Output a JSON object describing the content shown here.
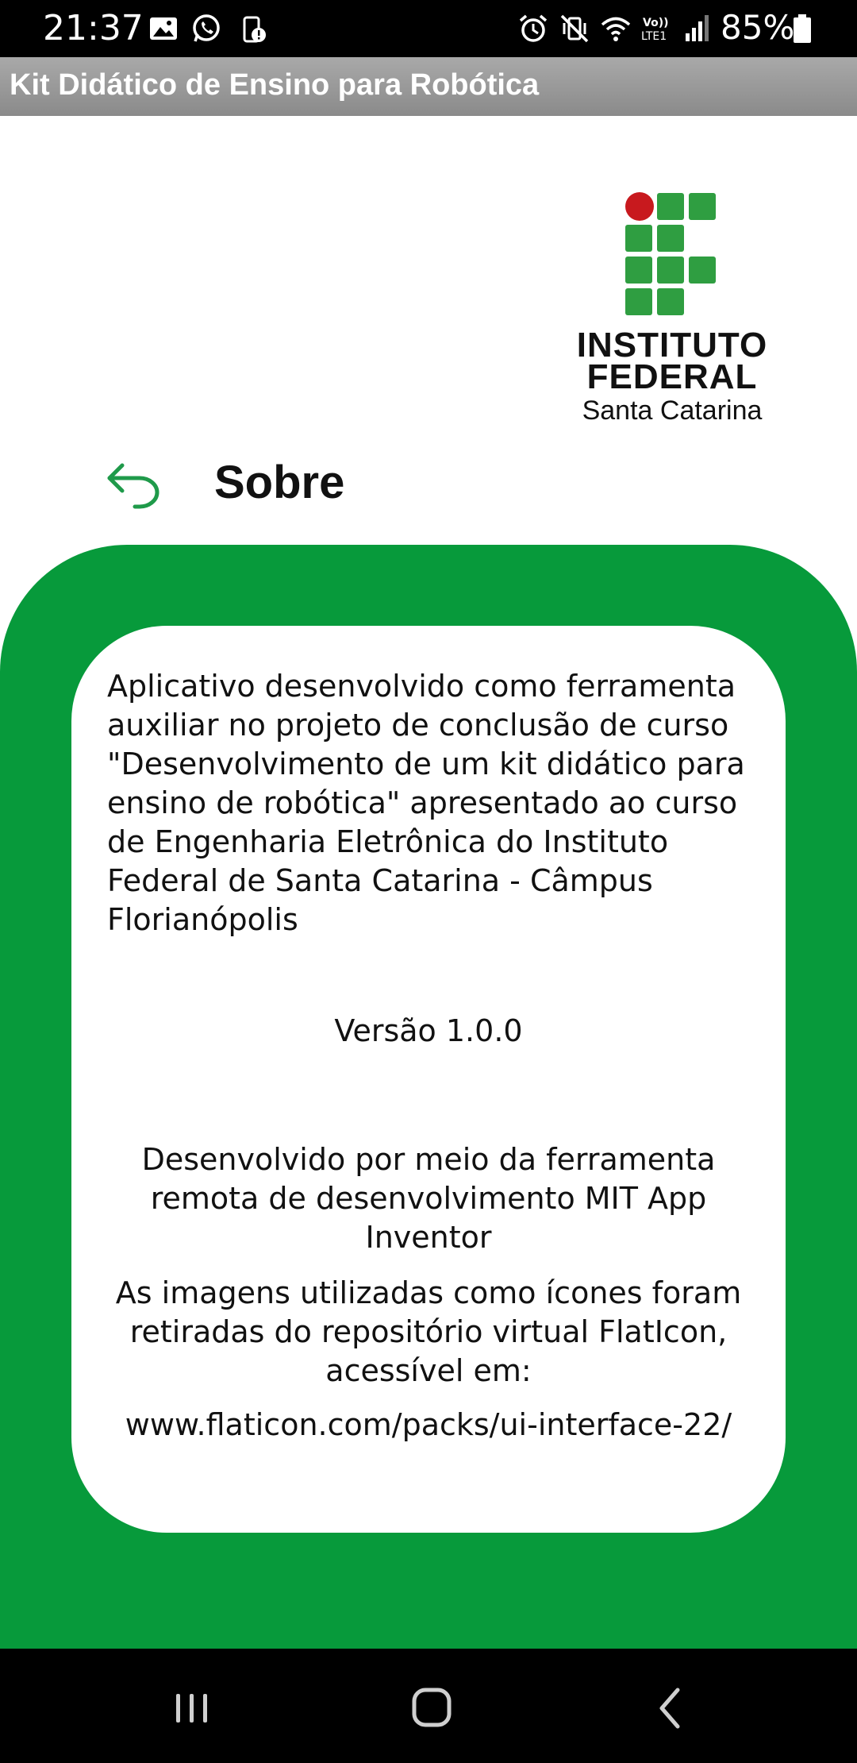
{
  "status_bar": {
    "time": "21:37",
    "battery_percent": "85%",
    "left_icons": [
      "image-icon",
      "whatsapp-icon",
      "phone-alert-icon"
    ],
    "right_icons": [
      "alarm-icon",
      "vibrate-icon",
      "wifi-icon",
      "volte-icon",
      "signal-icon",
      "battery-icon"
    ]
  },
  "app": {
    "title": "Kit Didático de Ensino para Robótica"
  },
  "logo": {
    "line1": "INSTITUTO",
    "line2": "FEDERAL",
    "line3": "Santa Catarina",
    "colors": {
      "green": "#2f9e41",
      "red": "#c8191e"
    }
  },
  "header": {
    "title": "Sobre",
    "back_icon": "back-arrow-icon"
  },
  "content": {
    "about": "Aplicativo desenvolvido como ferramenta auxiliar no projeto de conclusão de curso \"Desenvolvimento de um kit didático para ensino de robótica\" apresentado ao curso de Engenharia Eletrônica do Instituto Federal de Santa Catarina - Câmpus Florianópolis",
    "version": "Versão 1.0.0",
    "developed_with": "Desenvolvido por meio da ferramenta remota de desenvolvimento MIT App Inventor",
    "images_credit": "As imagens utilizadas como ícones foram retiradas do repositório virtual FlatIcon, acessível em:",
    "link": "www.flaticon.com/packs/ui-interface-22/"
  },
  "theme": {
    "panel_green": "#079a3b",
    "accent_green": "#1f9a4a",
    "title_bar_gray": "#999999"
  },
  "nav_bar": {
    "buttons": [
      "recents-icon",
      "home-icon",
      "back-icon"
    ]
  }
}
